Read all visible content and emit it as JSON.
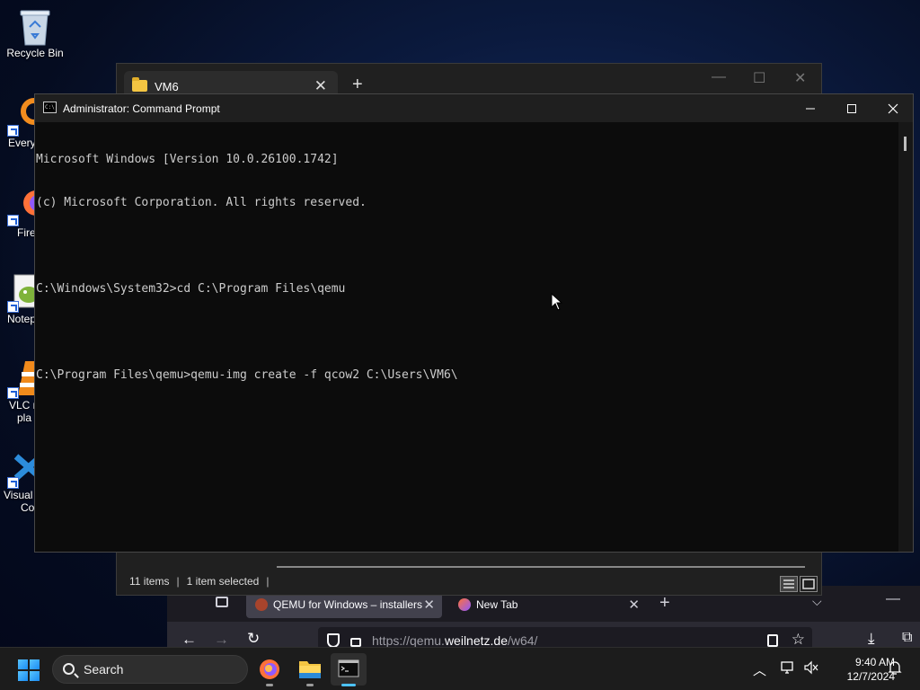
{
  "desktop": {
    "icons": [
      {
        "label": "Recycle Bin",
        "icon": "recycle-bin-icon"
      },
      {
        "label": "Every",
        "icon": "everything-icon"
      },
      {
        "label": "Fire",
        "icon": "firefox-icon"
      },
      {
        "label": "Notep",
        "icon": "notepad-plus-plus-icon"
      },
      {
        "label": "VLC r",
        "label2": "pla",
        "icon": "vlc-icon"
      },
      {
        "label": "Visual",
        "label2": "Co",
        "icon": "vscode-icon"
      }
    ]
  },
  "explorer": {
    "tab_title": "VM6",
    "tab_close": "✕",
    "new_tab": "+",
    "minimize": "—",
    "maximize": "☐",
    "close": "✕",
    "status_items": "11 items",
    "status_selected": "1 item selected",
    "status_sep": "|"
  },
  "cmd": {
    "title": "Administrator: Command Prompt",
    "icon_text": "C:\\",
    "lines": [
      "Microsoft Windows [Version 10.0.26100.1742]",
      "(c) Microsoft Corporation. All rights reserved.",
      "",
      "C:\\Windows\\System32>cd C:\\Program Files\\qemu",
      "",
      "C:\\Program Files\\qemu>qemu-img create -f qcow2 C:\\Users\\VM6\\"
    ]
  },
  "firefox": {
    "tabs": [
      {
        "label": "QEMU for Windows – installers",
        "active": true
      },
      {
        "label": "New Tab",
        "active": false
      }
    ],
    "url_prefix": "https://qemu.",
    "url_domain": "weilnetz.de",
    "url_path": "/w64/"
  },
  "taskbar": {
    "search_placeholder": "Search",
    "apps": [
      {
        "name": "firefox",
        "icon": "firefox-icon",
        "active": false
      },
      {
        "name": "file-explorer",
        "icon": "folder-icon",
        "active": false
      },
      {
        "name": "command-prompt",
        "icon": "terminal-icon",
        "active": true
      }
    ],
    "clock_time": "9:40 AM",
    "clock_date": "12/7/2024"
  },
  "colors": {
    "accent": "#4cc2ff",
    "terminal_bg": "#0c0c0c",
    "terminal_text": "#cccccc"
  }
}
